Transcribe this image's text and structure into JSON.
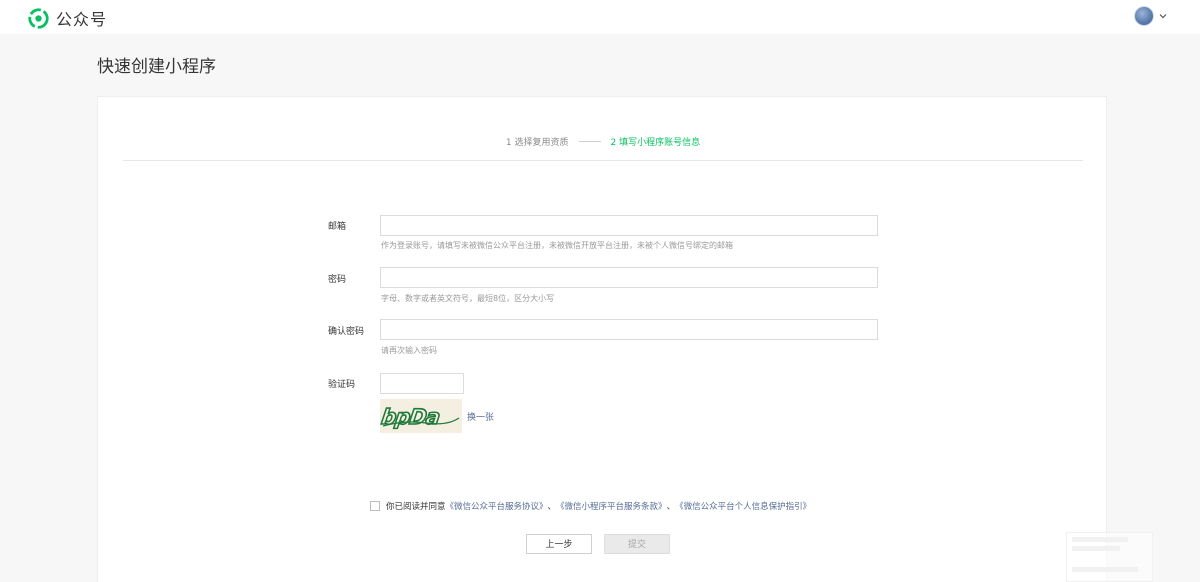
{
  "topbar": {
    "logo_text": "公众号"
  },
  "page": {
    "title": "快速创建小程序"
  },
  "steps": [
    {
      "label": "1 选择复用资质"
    },
    {
      "label": "2 填写小程序账号信息"
    }
  ],
  "form": {
    "email": {
      "label": "邮箱",
      "value": "",
      "hint": "作为登录账号，请填写未被微信公众平台注册，未被微信开放平台注册，未被个人微信号绑定的邮箱"
    },
    "password": {
      "label": "密码",
      "value": "",
      "hint": "字母、数字或者英文符号，最短8位，区分大小写"
    },
    "confirm_password": {
      "label": "确认密码",
      "value": "",
      "hint": "请再次输入密码"
    },
    "captcha": {
      "label": "验证码",
      "value": "",
      "image_text": "bpDa",
      "refresh_label": "换一张"
    }
  },
  "agreement": {
    "prefix": "你已阅读并同意",
    "links": [
      "《微信公众平台服务协议》",
      "《微信小程序平台服务条款》",
      "《微信公众平台个人信息保护指引》"
    ],
    "separators": [
      "、",
      "、"
    ]
  },
  "buttons": {
    "prev_label": "上一步",
    "submit_label": "提交"
  },
  "colors": {
    "accent_green": "#07c160",
    "link_blue": "#576b95",
    "captcha_green": "#1f7a3a"
  }
}
